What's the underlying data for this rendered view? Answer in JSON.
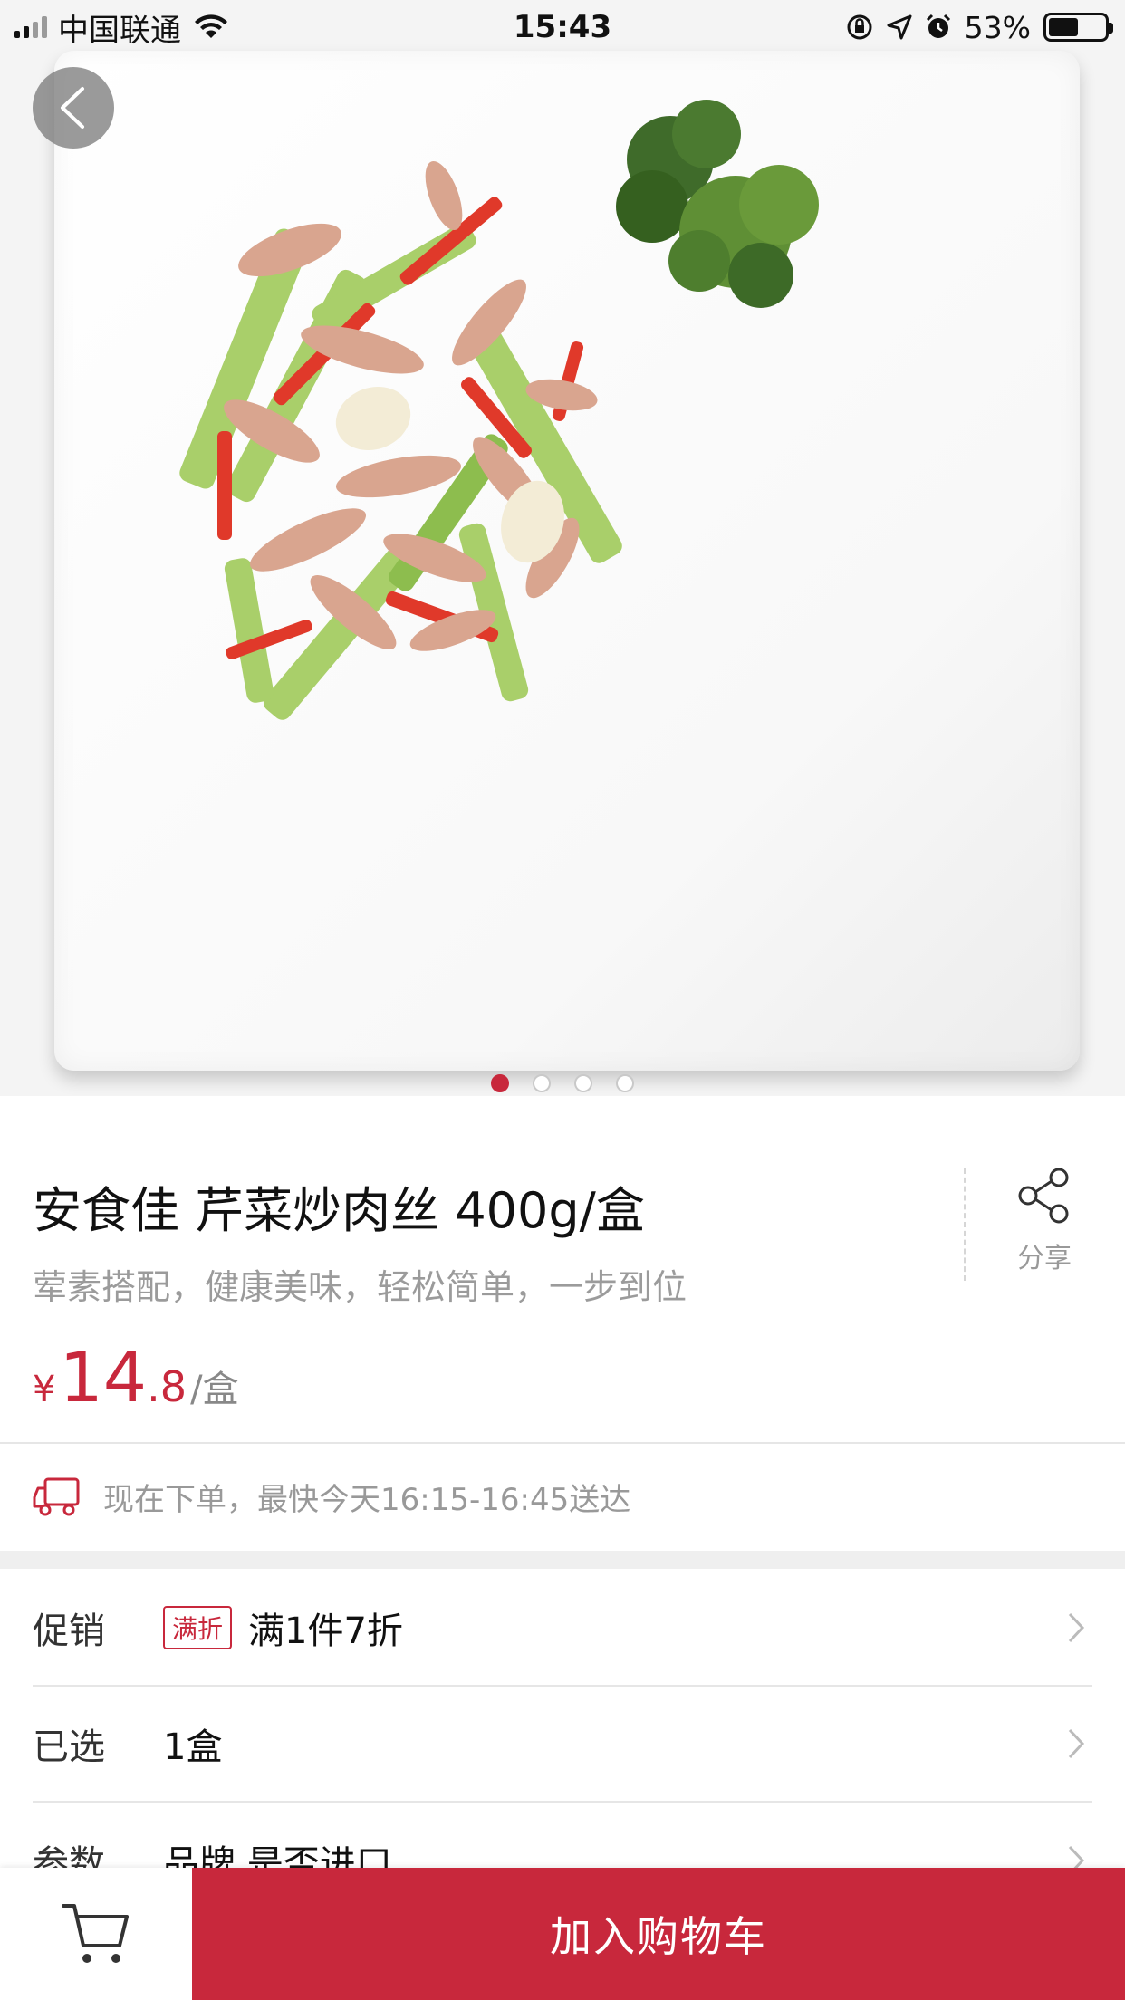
{
  "status_bar": {
    "carrier": "中国联通",
    "time": "15:43",
    "battery": "53%",
    "battery_level": 0.53
  },
  "gallery": {
    "page_count": 4,
    "active_index": 0
  },
  "product": {
    "title": "安食佳 芹菜炒肉丝 400g/盒",
    "subtitle": "荤素搭配，健康美味，轻松简单，一步到位",
    "share_label": "分享",
    "price": {
      "currency": "¥",
      "integer": "14",
      "decimal": ".8",
      "unit": "/盒"
    }
  },
  "delivery": {
    "text": "现在下单，最快今天16:15-16:45送达"
  },
  "rows": {
    "promo": {
      "label": "促销",
      "tag": "满折",
      "value": "满1件7折"
    },
    "selected": {
      "label": "已选",
      "value": "1盒"
    },
    "params": {
      "label": "参数",
      "value": "品牌 是否进口"
    }
  },
  "bottom_bar": {
    "add_to_cart": "加入购物车"
  },
  "colors": {
    "accent": "#c8283c"
  }
}
